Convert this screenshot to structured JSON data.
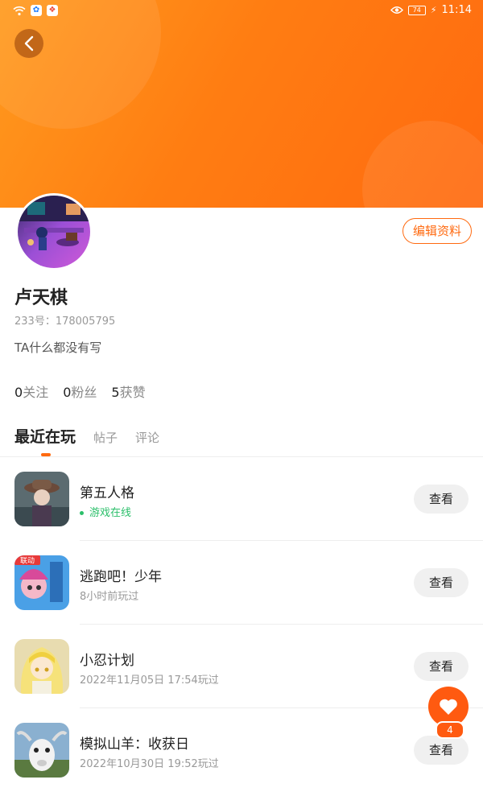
{
  "statusbar": {
    "time": "11:14",
    "battery": "74"
  },
  "profile": {
    "name": "卢天棋",
    "uid": "233号：178005795",
    "bio": "TA什么都没有写",
    "edit_label": "编辑资料"
  },
  "stats": [
    {
      "num": "0",
      "label": "关注"
    },
    {
      "num": "0",
      "label": "粉丝"
    },
    {
      "num": "5",
      "label": "获赞"
    }
  ],
  "tabs": [
    {
      "label": "最近在玩",
      "active": true
    },
    {
      "label": "帖子",
      "active": false
    },
    {
      "label": "评论",
      "active": false
    }
  ],
  "games": [
    {
      "title": "第五人格",
      "sub": "游戏在线",
      "online": true,
      "action": "查看"
    },
    {
      "title": "逃跑吧！少年",
      "sub": "8小时前玩过",
      "online": false,
      "action": "查看",
      "icon_badge": "联动"
    },
    {
      "title": "小忍计划",
      "sub": "2022年11月05日 17:54玩过",
      "online": false,
      "action": "查看"
    },
    {
      "title": "模拟山羊：收获日",
      "sub": "2022年10月30日 19:52玩过",
      "online": false,
      "action": "查看"
    }
  ],
  "fab": {
    "count": "4",
    "icon": "heart-icon"
  },
  "colors": {
    "accent": "#ff6a10",
    "online": "#2bbf6a"
  }
}
